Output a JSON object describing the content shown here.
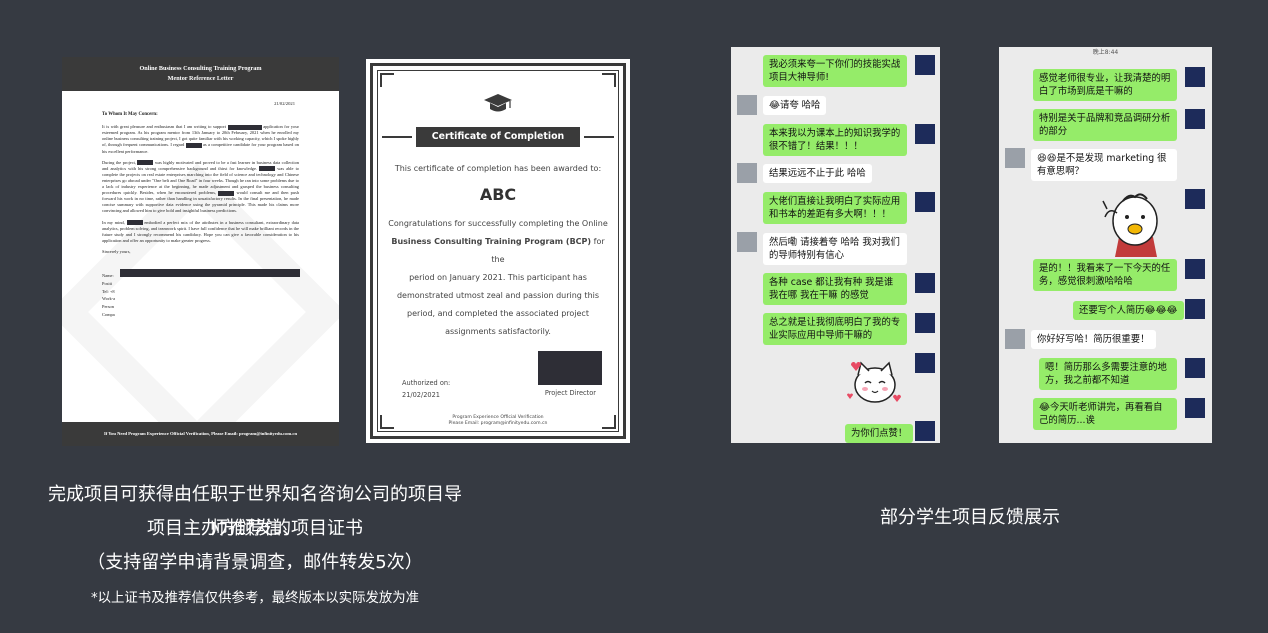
{
  "letter": {
    "title1": "Online Business Consulting Training Program",
    "title2": "Mentor  Reference  Letter",
    "date": "21/02/2021",
    "greeting": "To Whom It May Concern:",
    "p1a": "It is with great pleasure and enthusiasm that I am writing to support",
    "p1b": "application for your esteemed program. As his program mentor from 13th January to 20th February, 2021 when he enrolled my online business consulting training project, I got quite familiar with his working capacity, which I spoke highly of, through frequent communications. I regard",
    "p1c": "as a competitive candidate for your program based on his excellent performance.",
    "p2a": "During the project,",
    "p2b": "was highly motivated and proved to be a fast learner in business data collection and analytics with his strong comprehensive background and thirst for knowledge.",
    "p2c": "was able to complete the projects on real estate enterprises marching into the field of science and technology and Chinese enterprises go abroad under \"One belt and One Road\" in four weeks. Though he ran into some problems due to a lack of industry experience at the beginning, he made adjustment and grasped the business consulting procedures quickly. Besides, when he encountered problems,",
    "p2d": "would consult me and then push forward his work in no time, rather than handling in unsatisfactory results. In the final presentation, he made concise summary with supportive data evidence using the pyramid principle. This made his claims more convincing and allowed him to give bold and insightful business predictions.",
    "p3a": "In my mind,",
    "p3b": "embodied a perfect mix of the attributes in a business consultant, extraordinary data analytics, problem solving, and teamwork spirit. I have full confidence that he will make brilliant records in the future study and I strongly recommend his candidacy. Hope you can give a favorable consideration to his application and offer an opportunity to make greater progress.",
    "sign": "Sincerely yours,",
    "fields": [
      "Name:",
      "Positi",
      "Tel: +8",
      "Work-a",
      "Person",
      "Compa"
    ],
    "footer": "If You Need Program Experience Official Verification, Please Email: program@infinityedu.com.cn"
  },
  "certificate": {
    "banner": "Certificate  of  Completion",
    "awarded": "This certificate of completion has been awarded to:",
    "name": "ABC",
    "body1": "Congratulations for successfully completing the Online",
    "body2": "Business Consulting Training Program (BCP)",
    "body2b": " for the",
    "body3": "period on January 2021. This participant has",
    "body4": "demonstrated utmost zeal and passion during this",
    "body5": "period, and completed the associated project",
    "body6": "assignments satisfactorily.",
    "authorized": "Authorized on:",
    "date": "21/02/2021",
    "director": "Project Director",
    "verify1": "Program Experience Official Verification",
    "verify2": "Please Email: program@infinityedu.com.cn"
  },
  "captions": {
    "left1": "完成项目可获得由任职于世界知名咨询公司的项目导师推荐信、",
    "left2": "项目主办方颁发的项目证书",
    "left3": "（支持留学申请背景调查，邮件转发5次）",
    "note": "*以上证书及推荐信仅供参考，最终版本以实际发放为准",
    "right": "部分学生项目反馈展示"
  },
  "chat1": {
    "messages": [
      "我必须来夸一下你们的技能实战项目大神导师!",
      "😂请夸 哈哈",
      "本来我以为课本上的知识我学的很不错了！结果！！！",
      "结果远远不止于此 哈哈",
      "大佬们直接让我明白了实际应用和书本的差距有多大啊！！！",
      "然后嘞 请接着夸 哈哈 我对我们的导师特别有信心",
      "各种 case 都让我有种 我是谁 我在哪 我在干嘛 的感觉",
      "总之就是让我彻底明白了我的专业实际应用中导师干嘛的",
      "为你们点赞！"
    ]
  },
  "chat2": {
    "status": "晚上8:44",
    "messages": [
      "感觉老师很专业，让我清楚的明白了市场到底是干嘛的",
      "特别是关于品牌和竞品调研分析的部分",
      "😆😆是不是发现 marketing 很有意思啊？",
      "是的！！我看来了一下今天的任务，感觉很刺激哈哈哈",
      "还要写个人简历😂😂😂",
      "你好好写哈！简历很重要！",
      "嗯！简历那么多需要注意的地方，我之前都不知道",
      "😂今天听老师讲完，再看看自己的简历...诶"
    ]
  }
}
